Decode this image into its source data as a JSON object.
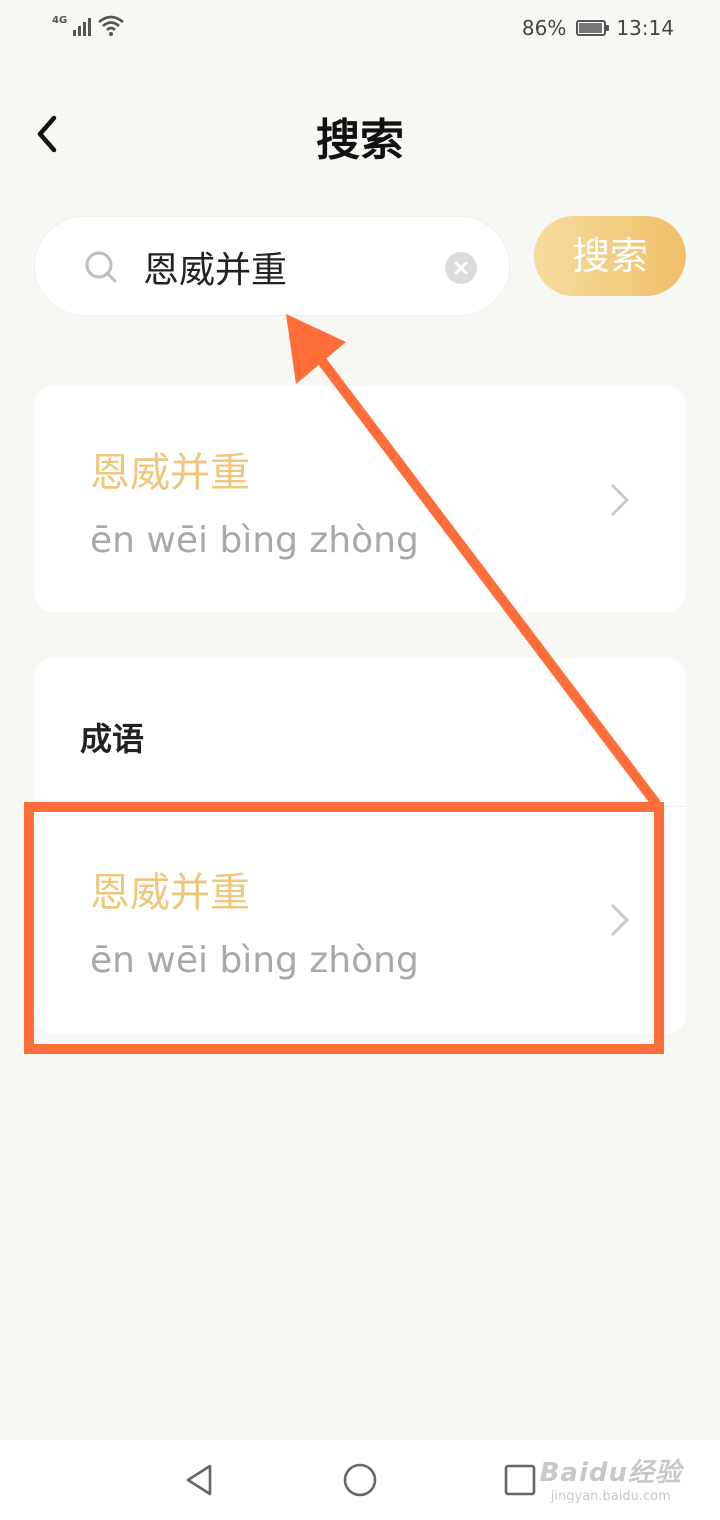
{
  "status_bar": {
    "network": "4G",
    "battery": "86%",
    "time": "13:14"
  },
  "header": {
    "title": "搜索",
    "back_icon": "chevron-left-icon"
  },
  "search": {
    "value": "恩威并重",
    "placeholder": "",
    "button_label": "搜索",
    "icon": "search-icon",
    "clear_icon": "clear-icon"
  },
  "results": {
    "top": {
      "word": "恩威并重",
      "pinyin": "ēn wēi bìng zhòng"
    },
    "section": {
      "heading": "成语",
      "item": {
        "word": "恩威并重",
        "pinyin": "ēn wēi bìng zhòng"
      }
    }
  },
  "watermark": {
    "main": "Baidu经验",
    "sub": "jingyan.baidu.com"
  },
  "colors": {
    "accent_word": "#edc77c",
    "button_gradient_start": "#f6dc9e",
    "button_gradient_end": "#efc069",
    "annotation": "#ff6d3a",
    "background": "#f7f7f4"
  }
}
